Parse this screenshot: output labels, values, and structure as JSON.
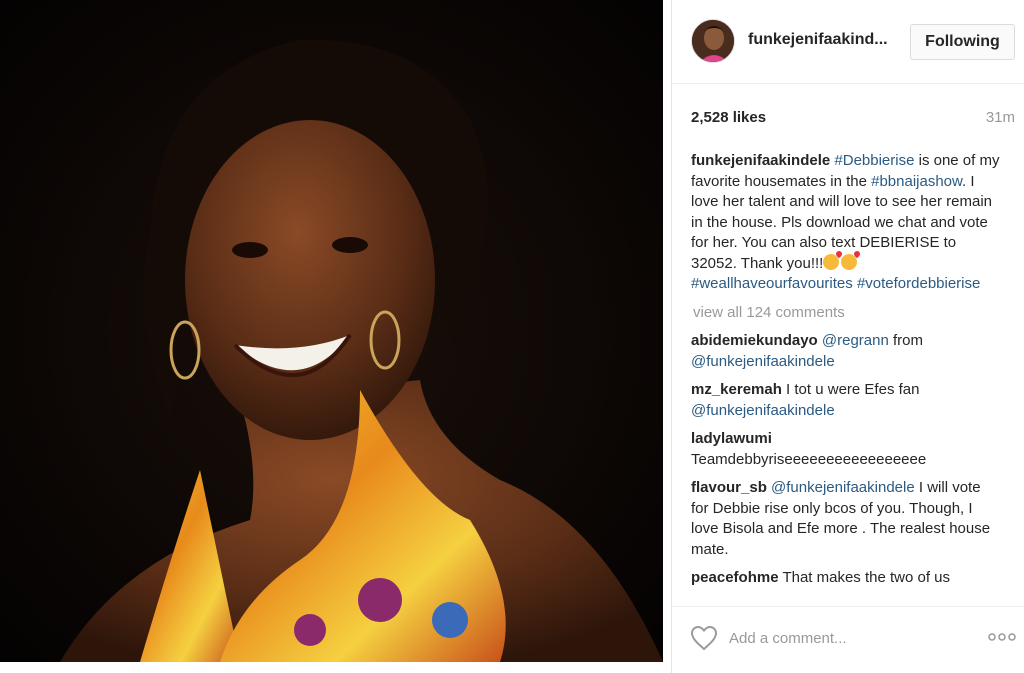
{
  "post": {
    "username": "funkejenifaakind...",
    "follow_label": "Following",
    "likes": "2,528 likes",
    "time_ago": "31m",
    "caption": {
      "author": "funkejenifaakindele",
      "tag1": "#Debbierise",
      "text1": " is one of my favorite housemates in the ",
      "tag2": "#bbnaijashow",
      "text2": ". I love her talent and will love to see her remain in the house. Pls download we chat and vote for her. You can also text DEBIERISE to 32052. Thank you!!!",
      "tag3": "#weallhaveourfavourites",
      "tag4": "#votefordebbierise"
    },
    "view_all_comments": "view all 124 comments",
    "comments": [
      {
        "author": "abidemiekundayo",
        "mention": "@regrann",
        "text": " from ",
        "mention2": "@funkejenifaakindele"
      },
      {
        "author": "mz_keremah",
        "text": " I tot u were Efes fan ",
        "mention": "@funkejenifaakindele"
      },
      {
        "author": "ladylawumi",
        "text": " Teamdebbyriseeeeeeeeeeeeeeeee"
      },
      {
        "author": "flavour_sb",
        "mention": "@funkejenifaakindele",
        "text": " I will vote for Debbie rise only bcos of you. Though, I love Bisola and Efe more . The realest house mate."
      },
      {
        "author": "peacefohme",
        "text": " That makes the two of us"
      }
    ],
    "add_comment_placeholder": "Add a comment...",
    "icons": {
      "like": "heart-outline-icon",
      "more": "more-options-icon"
    },
    "colors": {
      "hashtag": "#2b5a83",
      "muted": "#999999",
      "text": "#262626"
    }
  }
}
